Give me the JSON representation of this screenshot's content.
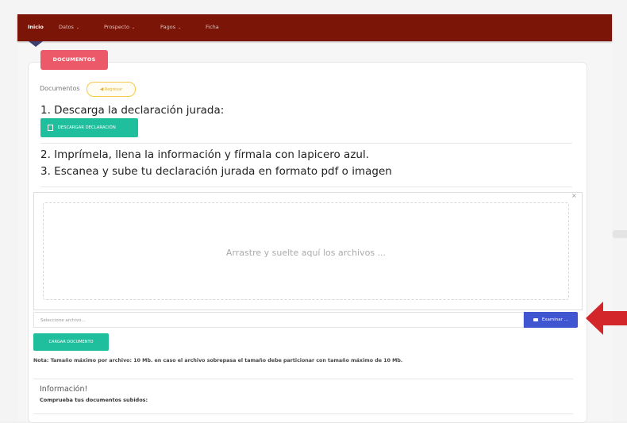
{
  "nav": {
    "items": [
      {
        "label": "Inicio",
        "active": true,
        "caret": false
      },
      {
        "label": "Datos",
        "active": false,
        "caret": true
      },
      {
        "label": "Prospecto",
        "active": false,
        "caret": true
      },
      {
        "label": "Pagos",
        "active": false,
        "caret": true
      },
      {
        "label": "Ficha",
        "active": false,
        "caret": false
      }
    ]
  },
  "section": {
    "tab_label": "DOCUMENTOS",
    "label": "Documentos",
    "back_button": "Regresar"
  },
  "steps": {
    "step1": "1. Descarga la declaración jurada:",
    "download_button": "DESCARGAR DECLARACIÓN",
    "step2": "2. Imprímela, llena la información y fírmala con lapicero azul.",
    "step3": "3. Escanea y sube tu declaración jurada en formato pdf o imagen"
  },
  "upload": {
    "dropzone_text": "Arrastre y suelte aquí los archivos ...",
    "close_symbol": "×",
    "file_placeholder": "Seleccione archivo...",
    "browse_button": "Examinar ...",
    "upload_button": "CARGAR DOCUMENTO"
  },
  "note": "Nota: Tamaño máximo por archivo: 10 Mb. en caso el archivo sobrepasa el tamaño debe particionar con tamaño máximo de 10 Mb.",
  "info": {
    "title": "Información!",
    "subtitle": "Comprueba tus documentos subidos:"
  },
  "icons": {
    "back": "arrow-left-icon",
    "download": "document-icon",
    "browse": "folder-open-icon",
    "caret": "chevron-down-icon"
  },
  "colors": {
    "navbar": "#7a1508",
    "tab_pink": "#ec5a6a",
    "green": "#1fbf9e",
    "blue": "#4055d0",
    "arrow_red": "#d2262b",
    "back_yellow": "#f5c94a"
  }
}
